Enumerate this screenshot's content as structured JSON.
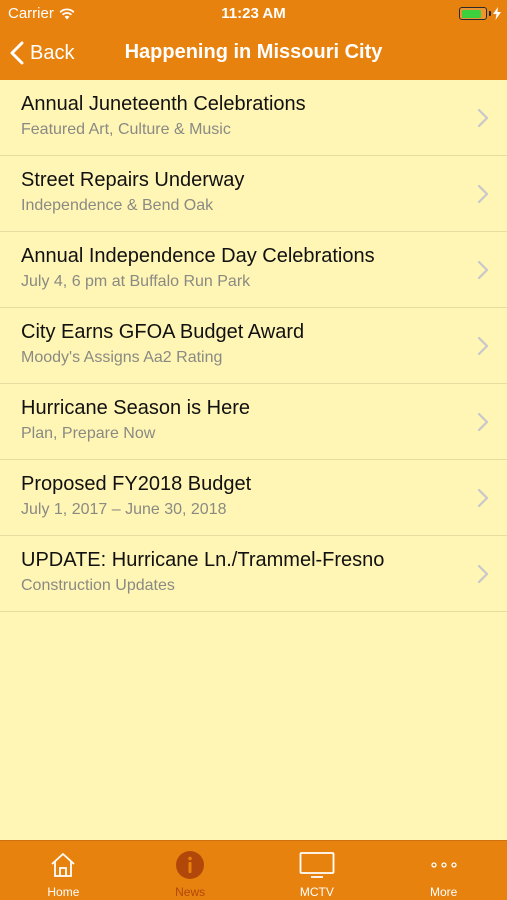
{
  "status_bar": {
    "carrier": "Carrier",
    "time": "11:23 AM",
    "battery_level": 0.85
  },
  "nav": {
    "back_label": "Back",
    "title": "Happening in Missouri City"
  },
  "items": [
    {
      "title": "Annual Juneteenth Celebrations",
      "subtitle": "Featured Art, Culture & Music"
    },
    {
      "title": "Street Repairs Underway",
      "subtitle": "Independence & Bend Oak"
    },
    {
      "title": "Annual Independence Day Celebrations",
      "subtitle": "July 4, 6 pm at Buffalo Run Park"
    },
    {
      "title": "City Earns GFOA Budget Award",
      "subtitle": "Moody's Assigns Aa2 Rating"
    },
    {
      "title": "Hurricane Season is Here",
      "subtitle": "Plan, Prepare Now"
    },
    {
      "title": "Proposed FY2018 Budget",
      "subtitle": "July 1, 2017 – June 30, 2018"
    },
    {
      "title": "UPDATE: Hurricane Ln./Trammel-Fresno",
      "subtitle": "Construction Updates"
    }
  ],
  "tabs": [
    {
      "label": "Home",
      "icon": "home-icon",
      "active": false
    },
    {
      "label": "News",
      "icon": "info-icon",
      "active": true
    },
    {
      "label": "MCTV",
      "icon": "tv-icon",
      "active": false
    },
    {
      "label": "More",
      "icon": "more-icon",
      "active": false
    }
  ],
  "colors": {
    "accent": "#E8820E",
    "background": "#FFF5B4",
    "active_tab": "#B2470A"
  }
}
